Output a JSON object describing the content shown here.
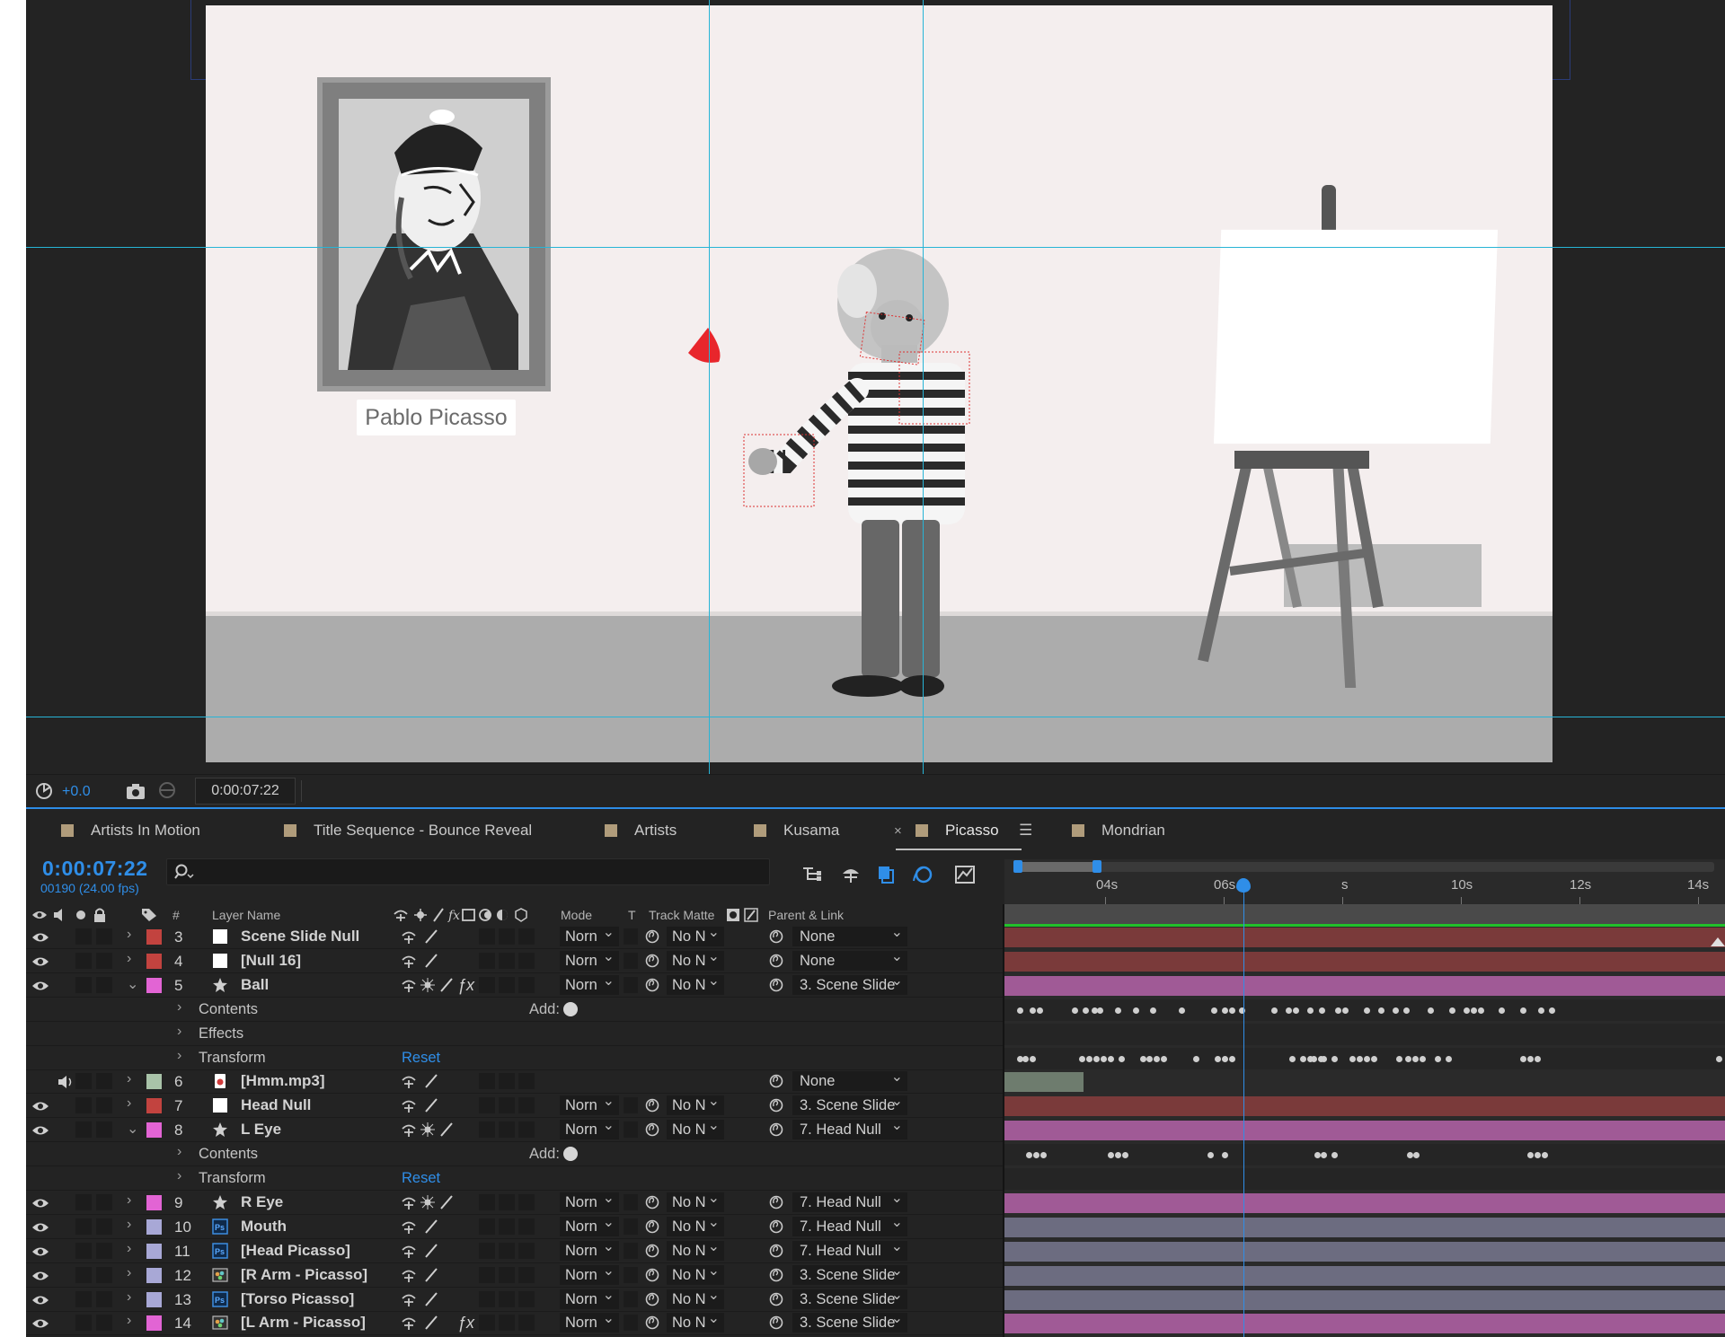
{
  "viewer": {
    "portrait_label": "Pablo Picasso",
    "exposure_value": "+0.0",
    "timecode": "0:00:07:22"
  },
  "tabs": [
    {
      "label": "Artists In Motion"
    },
    {
      "label": "Title Sequence - Bounce Reveal"
    },
    {
      "label": "Artists"
    },
    {
      "label": "Kusama"
    },
    {
      "label": "Picasso",
      "active": true
    },
    {
      "label": "Mondrian"
    }
  ],
  "tab_close": "×",
  "tab_menu": "☰",
  "timeline": {
    "timecode": "0:00:07:22",
    "frame_info": "00190 (24.00 fps)",
    "search_value": "",
    "current_time_seconds": 7.92,
    "ruler_labels": [
      "04s",
      "06s",
      "s",
      "10s",
      "12s",
      "14s"
    ],
    "columns": {
      "num": "#",
      "layer_name": "Layer Name",
      "mode": "Mode",
      "t": "T",
      "track_matte": "Track Matte",
      "parent_link": "Parent & Link"
    }
  },
  "colors": {
    "accent_blue": "#2f8ee8",
    "label_red": "#c2433f",
    "label_pink": "#e264d4",
    "label_sage": "#a9c3a9",
    "label_lavender": "#a8a8d6",
    "bar_red": "#7a3a3a",
    "bar_pink": "#a05a96",
    "bar_lavender": "#6c6c80"
  },
  "layers": [
    {
      "type": "layer",
      "eye": true,
      "twirl": "›",
      "label": "red",
      "num": "3",
      "src": "solid-white",
      "name": "Scene Slide Null",
      "mode": "Norn",
      "tm": "No N",
      "parent": "None",
      "bar": "red"
    },
    {
      "type": "layer",
      "eye": true,
      "twirl": "›",
      "label": "red",
      "num": "4",
      "src": "solid-white",
      "name": "[Null 16]",
      "mode": "Norn",
      "tm": "No N",
      "parent": "None",
      "bar": "red"
    },
    {
      "type": "layer",
      "eye": true,
      "twirl": "⌄",
      "label": "pink",
      "num": "5",
      "src": "star",
      "name": "Ball",
      "mode": "Norn",
      "tm": "No N",
      "parent": "3. Scene Slide",
      "bar": "pink",
      "fx": true,
      "collapse": true
    },
    {
      "type": "sub",
      "name": "Contents",
      "add": "Add:"
    },
    {
      "type": "sub",
      "name": "Effects"
    },
    {
      "type": "sub",
      "name": "Transform",
      "reset": "Reset"
    },
    {
      "type": "layer",
      "speaker": true,
      "twirl": "›",
      "label": "sage",
      "num": "6",
      "src": "audio",
      "name": "[Hmm.mp3]",
      "parent": "None",
      "bar": "audio"
    },
    {
      "type": "layer",
      "eye": true,
      "twirl": "›",
      "label": "red",
      "num": "7",
      "src": "solid-white",
      "name": "Head Null",
      "mode": "Norn",
      "tm": "No N",
      "parent": "3. Scene Slide",
      "bar": "red"
    },
    {
      "type": "layer",
      "eye": true,
      "twirl": "⌄",
      "label": "pink",
      "num": "8",
      "src": "star",
      "name": "L Eye",
      "mode": "Norn",
      "tm": "No N",
      "parent": "7. Head Null",
      "bar": "pink",
      "collapse": true
    },
    {
      "type": "sub",
      "name": "Contents",
      "add": "Add:"
    },
    {
      "type": "sub",
      "name": "Transform",
      "reset": "Reset"
    },
    {
      "type": "layer",
      "eye": true,
      "twirl": "›",
      "label": "pink",
      "num": "9",
      "src": "star",
      "name": "R Eye",
      "mode": "Norn",
      "tm": "No N",
      "parent": "7. Head Null",
      "bar": "pink",
      "collapse": true
    },
    {
      "type": "layer",
      "eye": true,
      "twirl": "›",
      "label": "lavender",
      "num": "10",
      "src": "psd",
      "name": "Mouth",
      "mode": "Norn",
      "tm": "No N",
      "parent": "7. Head Null",
      "bar": "lavender"
    },
    {
      "type": "layer",
      "eye": true,
      "twirl": "›",
      "label": "lavender",
      "num": "11",
      "src": "psd",
      "name": "[Head Picasso]",
      "mode": "Norn",
      "tm": "No N",
      "parent": "7. Head Null",
      "bar": "lavender"
    },
    {
      "type": "layer",
      "eye": true,
      "twirl": "›",
      "label": "lavender",
      "num": "12",
      "src": "comp",
      "name": "[R Arm - Picasso]",
      "mode": "Norn",
      "tm": "No N",
      "parent": "3. Scene Slide",
      "bar": "lavender"
    },
    {
      "type": "layer",
      "eye": true,
      "twirl": "›",
      "label": "lavender",
      "num": "13",
      "src": "psd",
      "name": "[Torso Picasso]",
      "mode": "Norn",
      "tm": "No N",
      "parent": "3. Scene Slide",
      "bar": "lavender"
    },
    {
      "type": "layer",
      "eye": true,
      "twirl": "›",
      "label": "pink",
      "num": "14",
      "src": "comp",
      "name": "[L Arm - Picasso]",
      "mode": "Norn",
      "tm": "No N",
      "parent": "3. Scene Slide",
      "bar": "pink",
      "fx": true
    }
  ]
}
